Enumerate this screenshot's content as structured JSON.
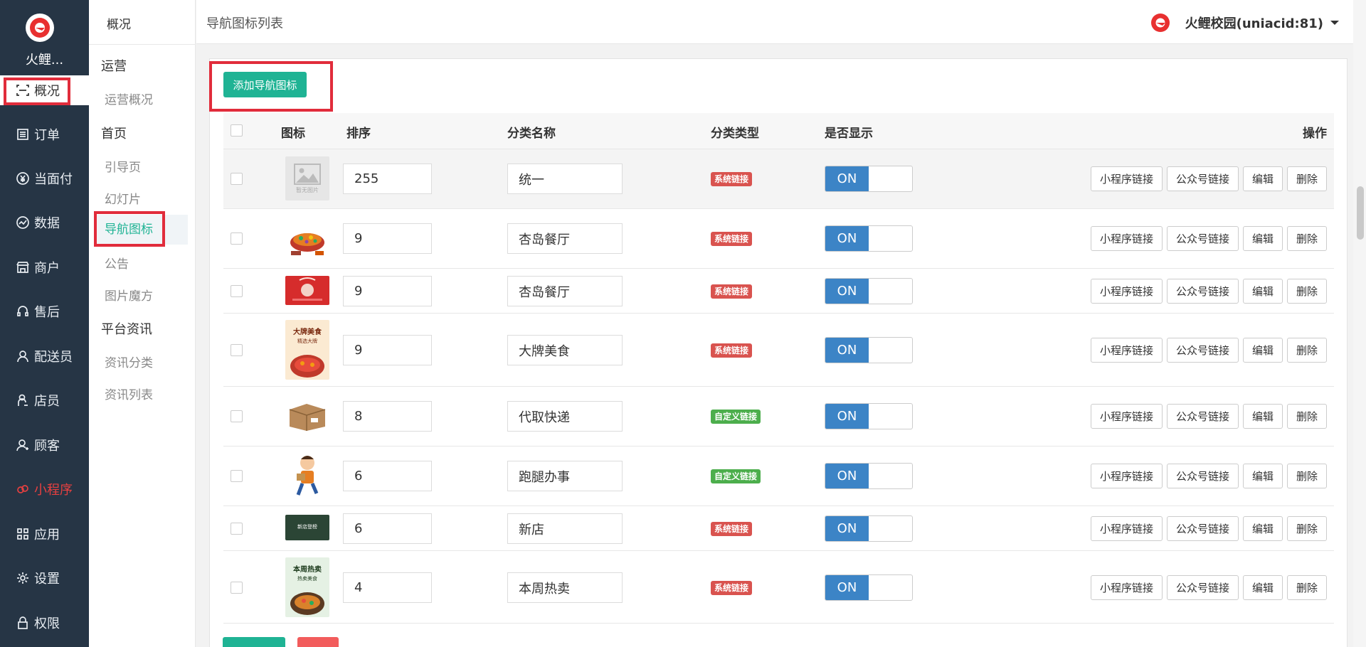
{
  "app": {
    "brand": "火鲤...",
    "page_title": "导航图标列表",
    "user_name": "火鲤校园(uniacid:81)"
  },
  "sidebar": {
    "items": [
      {
        "label": "概况",
        "icon": "scan-icon"
      },
      {
        "label": "订单",
        "icon": "list-icon"
      },
      {
        "label": "当面付",
        "icon": "yen-icon"
      },
      {
        "label": "数据",
        "icon": "chart-icon"
      },
      {
        "label": "商户",
        "icon": "store-icon"
      },
      {
        "label": "售后",
        "icon": "headset-icon"
      },
      {
        "label": "配送员",
        "icon": "user-icon"
      },
      {
        "label": "店员",
        "icon": "staff-icon"
      },
      {
        "label": "顾客",
        "icon": "customer-icon"
      },
      {
        "label": "小程序",
        "icon": "miniprogram-icon"
      },
      {
        "label": "应用",
        "icon": "apps-icon"
      },
      {
        "label": "设置",
        "icon": "gear-icon"
      },
      {
        "label": "权限",
        "icon": "lock-icon"
      }
    ]
  },
  "submenu": {
    "title": "概况",
    "groups": [
      {
        "label": "运营",
        "items": [
          "运营概况"
        ]
      },
      {
        "label": "首页",
        "items": [
          "引导页",
          "幻灯片",
          "导航图标",
          "公告",
          "图片魔方"
        ]
      },
      {
        "label": "平台资讯",
        "items": [
          "资讯分类",
          "资讯列表"
        ]
      }
    ]
  },
  "toolbar": {
    "add_label": "添加导航图标"
  },
  "table": {
    "headers": {
      "icon": "图标",
      "order": "排序",
      "name": "分类名称",
      "type": "分类类型",
      "show": "是否显示",
      "ops": "操作"
    },
    "toggle_on": "ON",
    "actions": [
      "小程序链接",
      "公众号链接",
      "编辑",
      "删除"
    ],
    "placeholder_text": "暂无图片",
    "rows": [
      {
        "order": "255",
        "name": "统一",
        "type": "系统链接",
        "thumb": "placeholder"
      },
      {
        "order": "9",
        "name": "杏岛餐厅",
        "type": "系统链接",
        "thumb": "hotpot"
      },
      {
        "order": "9",
        "name": "杏岛餐厅",
        "type": "系统链接",
        "thumb": "red-banner"
      },
      {
        "order": "9",
        "name": "大牌美食",
        "type": "系统链接",
        "thumb": "food-poster",
        "poster_line1": "大牌美食",
        "poster_line2": "精选大牌"
      },
      {
        "order": "8",
        "name": "代取快递",
        "type": "自定义链接",
        "thumb": "parcel"
      },
      {
        "order": "6",
        "name": "跑腿办事",
        "type": "自定义链接",
        "thumb": "courier"
      },
      {
        "order": "6",
        "name": "新店",
        "type": "系统链接",
        "thumb": "new-store",
        "poster_line1": "新店登榜"
      },
      {
        "order": "4",
        "name": "本周热卖",
        "type": "系统链接",
        "thumb": "hot-poster",
        "poster_line1": "本周热卖",
        "poster_line2": "热卖美食"
      }
    ]
  },
  "colors": {
    "sidebar_bg": "#263545",
    "accent": "#1fb394",
    "toggle_on": "#3c84c6",
    "badge_system": "#d9534f",
    "badge_custom": "#4cae4c",
    "highlight_box": "#e12c3b"
  }
}
